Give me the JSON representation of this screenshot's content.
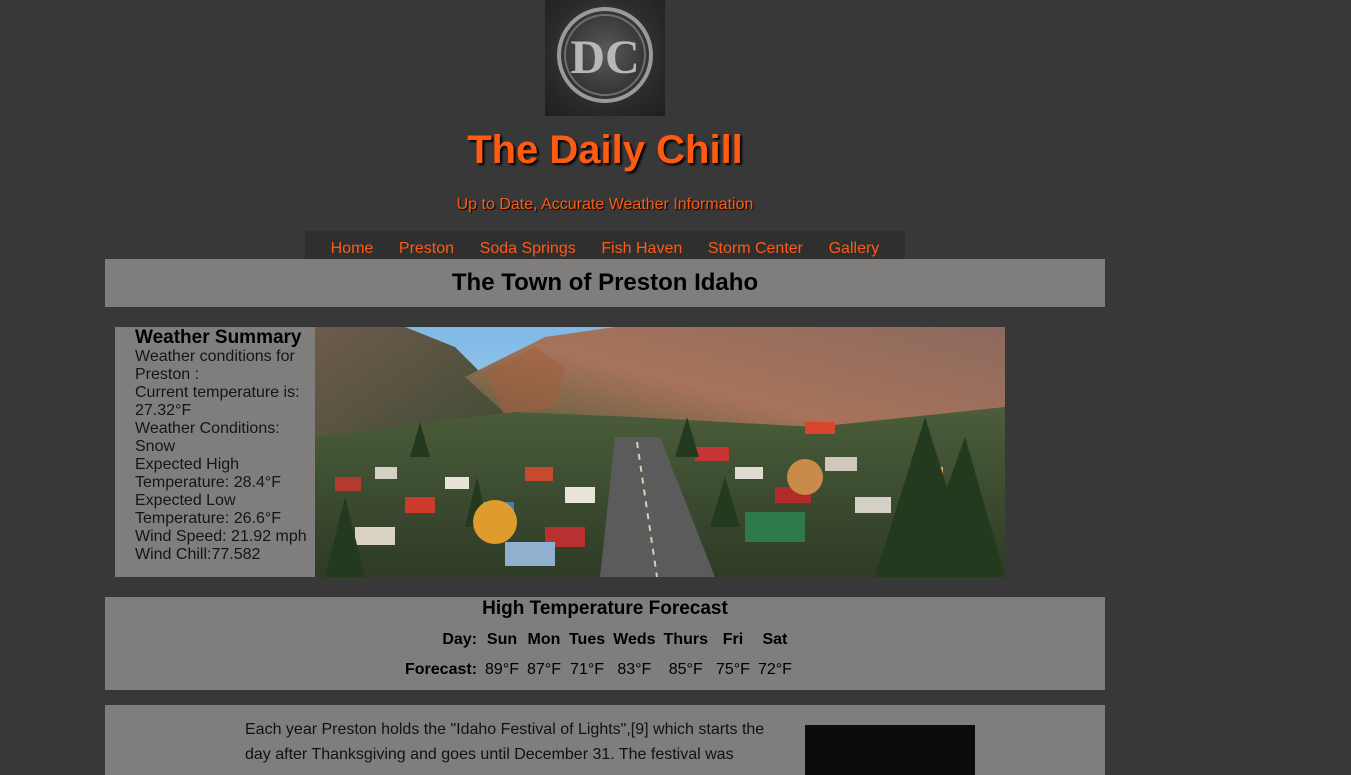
{
  "logo": {
    "text": "DC"
  },
  "header": {
    "title": "The Daily Chill",
    "tagline": "Up to Date, Accurate Weather Information"
  },
  "nav": {
    "items": [
      "Home",
      "Preston",
      "Soda Springs",
      "Fish Haven",
      "Storm Center",
      "Gallery"
    ]
  },
  "page": {
    "heading": "The Town of Preston Idaho"
  },
  "summary": {
    "title": "Weather Summary",
    "lines": [
      "Weather conditions for Preston :",
      "Current temperature is: 27.32°F",
      "Weather Conditions: Snow",
      "Expected High Temperature: 28.4°F",
      "Expected Low Temperature: 26.6°F",
      "Wind Speed: 21.92 mph",
      "Wind Chill:77.582"
    ]
  },
  "forecast": {
    "title": "High Temperature Forecast",
    "day_label": "Day:",
    "forecast_label": "Forecast:",
    "days": [
      "Sun",
      "Mon",
      "Tues",
      "Weds",
      "Thurs",
      "Fri",
      "Sat"
    ],
    "temps": [
      "89°F",
      "87°F",
      "71°F",
      "83°F",
      "85°F",
      "75°F",
      "72°F"
    ]
  },
  "article": {
    "text": "Each year Preston holds the \"Idaho Festival of Lights\",[9] which starts the day after Thanksgiving and goes until December 31. The festival was"
  }
}
